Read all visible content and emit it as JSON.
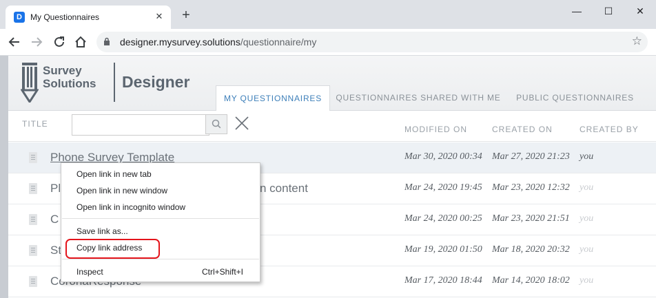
{
  "browser": {
    "tab_title": "My Questionnaires",
    "tab_favicon": "D",
    "close_glyph": "✕",
    "newtab_glyph": "+",
    "window_controls": {
      "minimize": "—",
      "maximize": "☐",
      "close": "✕"
    },
    "url_host": "designer.mysurvey.solutions",
    "url_path": "/questionnaire/my"
  },
  "app": {
    "logo_line1": "Survey",
    "logo_line2": "Solutions",
    "product": "Designer",
    "tabs": [
      {
        "label": "MY QUESTIONNAIRES",
        "active": true
      },
      {
        "label": "QUESTIONNAIRES SHARED WITH ME",
        "active": false
      },
      {
        "label": "PUBLIC QUESTIONNAIRES",
        "active": false
      }
    ],
    "filter": {
      "title_label": "TITLE",
      "search_value": "",
      "col_modified": "MODIFIED ON",
      "col_created": "CREATED ON",
      "col_created_by": "CREATED BY"
    },
    "rows": [
      {
        "title": "Phone Survey Template",
        "modified": "Mar 30, 2020 00:34",
        "created": "Mar 27, 2020 21:23",
        "by": "you"
      },
      {
        "title": "Pl",
        "title_tail": "n content",
        "modified": "Mar 24, 2020 19:45",
        "created": "Mar 23, 2020 12:32",
        "by": "you"
      },
      {
        "title": "C",
        "modified": "Mar 24, 2020 00:25",
        "created": "Mar 23, 2020 21:51",
        "by": "you"
      },
      {
        "title": "St",
        "modified": "Mar 19, 2020 01:50",
        "created": "Mar 18, 2020 20:32",
        "by": "you"
      },
      {
        "title": "CoronaResponse",
        "modified": "Mar 17, 2020 18:44",
        "created": "Mar 14, 2020 18:02",
        "by": "you"
      }
    ]
  },
  "context_menu": {
    "items": [
      {
        "label": "Open link in new tab"
      },
      {
        "label": "Open link in new window"
      },
      {
        "label": "Open link in incognito window"
      },
      {
        "label": "Save link as..."
      },
      {
        "label": "Copy link address",
        "highlighted": true
      },
      {
        "label": "Inspect",
        "shortcut": "Ctrl+Shift+I"
      }
    ]
  },
  "colors": {
    "accent": "#3d7fb9",
    "highlight_ring": "#e4141b",
    "header_text": "#5c6670"
  }
}
